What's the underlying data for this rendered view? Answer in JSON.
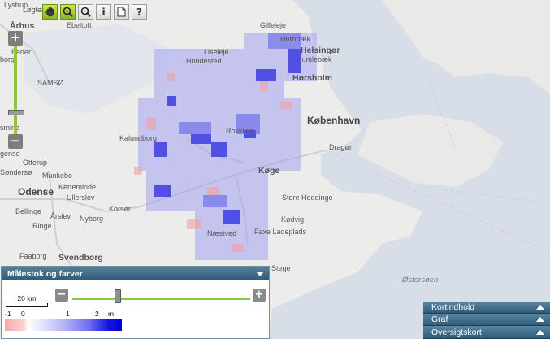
{
  "map": {
    "labels": {
      "lystrup": "Lystrup",
      "logten": "Løgten",
      "ebeltoft": "Ebeltoft",
      "arhus": "Århus",
      "beder": "Beder",
      "borg": "borg",
      "samso": "SAMSØ",
      "smine": "smine",
      "gense": "gense",
      "otterup": "Otterup",
      "sendersa": "Søndersø",
      "munkebo": "Munkebo",
      "kerteminde": "Kerteminde",
      "ullerslev": "Ullerslev",
      "odense": "Odense",
      "bellinge": "Bellinge",
      "arslev": "Årslev",
      "nyborg": "Nyborg",
      "korsor": "Korsør",
      "ringe": "Ringe",
      "faaborg": "Faaborg",
      "svendborg": "Svendborg",
      "gilleleje": "Gilleleje",
      "hornbaek": "Hornbæk",
      "helsingor": "Helsingør",
      "humlebaek": "Humlebæk",
      "horsholm": "Hørsholm",
      "liseleje": "Liseleje",
      "hundested": "Hundested",
      "kobenhavn": "København",
      "kalundborg": "Kalundborg",
      "roskilde": "Roskilde",
      "dragor": "Dragør",
      "koge": "Køge",
      "store_heddinge": "Store Heddinge",
      "kodvig": "Kødvig",
      "faxe_ladeplads": "Faxe Ladeplads",
      "naestved": "Næstved",
      "stege": "Stege",
      "ostersoen": "Østersøen"
    }
  },
  "toolbar": {
    "pan_icon": "hand-pan-icon",
    "zoom_in_icon": "zoom-in-icon",
    "zoom_out_icon": "zoom-out-icon",
    "info_label": "i",
    "page_icon": "page-icon",
    "help_label": "?"
  },
  "zoom": {
    "plus": "+",
    "minus": "−"
  },
  "legend": {
    "title": "Målestok og farver",
    "scale_label": "20 km",
    "minus": "−",
    "plus": "+",
    "ramp_ticks": [
      "-1",
      "0",
      "1",
      "2",
      "m"
    ]
  },
  "panels": [
    {
      "label": "Kortindhold"
    },
    {
      "label": "Graf"
    },
    {
      "label": "Oversigtskort"
    }
  ],
  "colors": {
    "panel": "#3b6785",
    "accent_green": "#8dc63f",
    "sea": "#d7dee8",
    "land": "#ececea",
    "rise": "#2a2ae0",
    "subside": "#f4a0a0"
  }
}
